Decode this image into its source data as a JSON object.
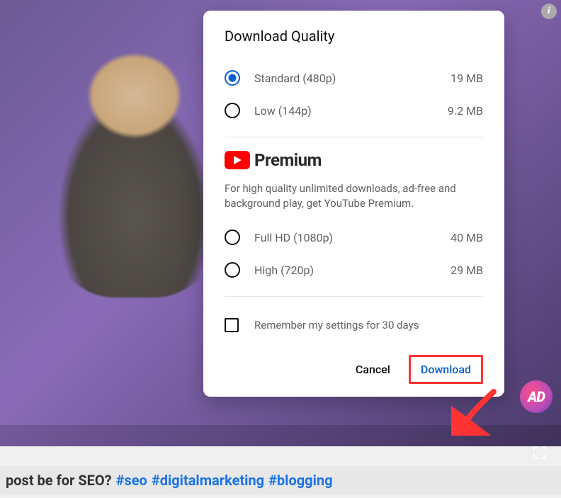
{
  "dialog": {
    "title": "Download Quality",
    "free_options": [
      {
        "label": "Standard (480p)",
        "size": "19 MB",
        "selected": true
      },
      {
        "label": "Low (144p)",
        "size": "9.2 MB",
        "selected": false
      }
    ],
    "premium": {
      "brand": "Premium",
      "description": "For high quality unlimited downloads, ad-free and background play, get YouTube Premium.",
      "options": [
        {
          "label": "Full HD (1080p)",
          "size": "40 MB"
        },
        {
          "label": "High (720p)",
          "size": "29 MB"
        }
      ]
    },
    "remember": "Remember my settings for 30 days",
    "cancel": "Cancel",
    "download": "Download"
  },
  "caption": {
    "text_prefix": "post be for SEO?",
    "tags": [
      "#seo",
      "#digitalmarketing",
      "#blogging"
    ]
  },
  "avatar_text": "AD",
  "info_glyph": "i",
  "colors": {
    "accent_blue": "#065fd4",
    "highlight_red": "#ff3333",
    "yt_red": "#ff0000"
  }
}
